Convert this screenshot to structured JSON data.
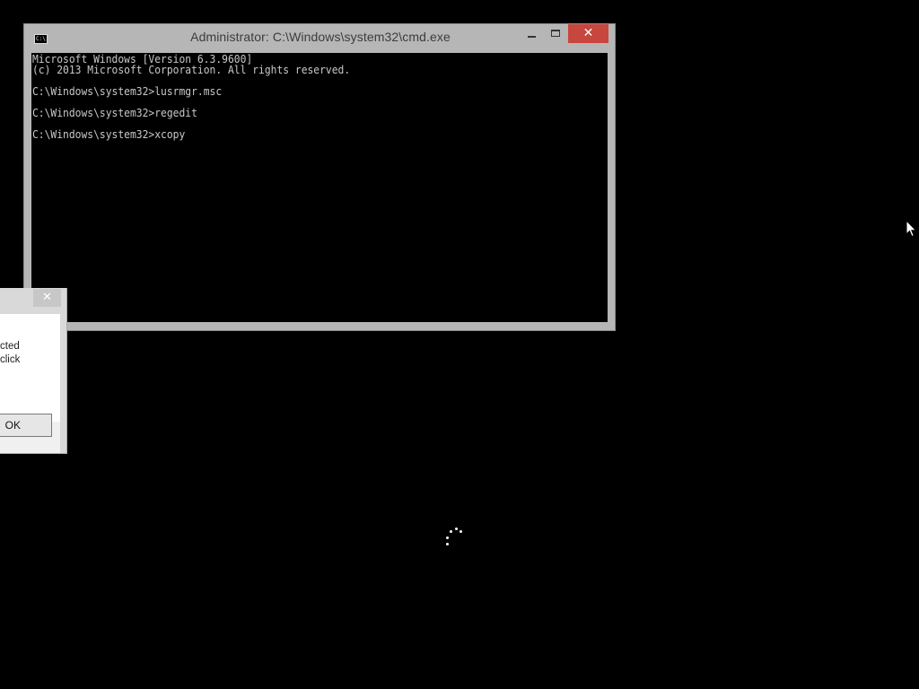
{
  "cmd_window": {
    "title": "Administrator: C:\\Windows\\system32\\cmd.exe",
    "app_icon_label": "C:\\",
    "close_glyph": "✕",
    "console_lines": [
      "Microsoft Windows [Version 6.3.9600]",
      "(c) 2013 Microsoft Corporation. All rights reserved.",
      "",
      "C:\\Windows\\system32>lusrmgr.msc",
      "",
      "C:\\Windows\\system32>regedit",
      "",
      "C:\\Windows\\system32>xcopy"
    ]
  },
  "message_box": {
    "close_glyph": "✕",
    "text_lines": [
      "cted",
      "click"
    ],
    "ok_label": "OK"
  },
  "icons": {
    "cmd_app": "command-prompt-icon",
    "minimize": "minimize-icon",
    "maximize": "maximize-icon",
    "close": "close-icon",
    "spinner": "loading-spinner-icon",
    "cursor": "mouse-pointer-icon"
  },
  "colors": {
    "desktop_background": "#000000",
    "window_frame": "#b6b6b6",
    "close_button": "#c7463e",
    "console_background": "#000000",
    "console_text": "#c8c8c8"
  }
}
